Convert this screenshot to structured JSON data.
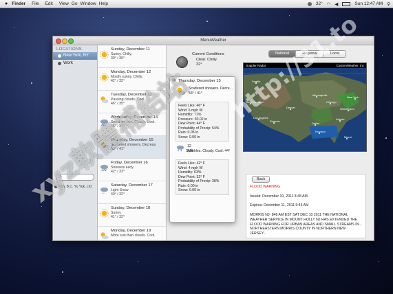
{
  "menubar": {
    "apple": "",
    "app": "Finder",
    "items": [
      "File",
      "Edit",
      "View",
      "Go",
      "Window",
      "Help"
    ],
    "weather": "32°",
    "clock": "Sun 12:47 AM"
  },
  "window": {
    "title": "MenuWeather"
  },
  "sidebar": {
    "header": "LOCATIONS",
    "locations": [
      {
        "label": "New York, NY"
      },
      {
        "label": "Work"
      }
    ],
    "search_placeholder": "Q-",
    "note": "Atlin, B.C. Yu Yuk, Ltd"
  },
  "forecast": [
    {
      "date": "Sunday, December 11",
      "desc": "Sunny. Chilly.",
      "temp": "39° / 30°",
      "icon": "sun-icon"
    },
    {
      "date": "Monday, December 12",
      "desc": "Mostly sunny. Chilly.",
      "temp": "42° / 32°",
      "icon": "sun-icon"
    },
    {
      "date": "Tuesday, December 13",
      "desc": "Passing clouds. Cool.",
      "temp": "46° / 35°",
      "icon": "partly-cloudy-icon"
    },
    {
      "date": "Wednesday, December 14",
      "desc": "Sprinkles late. Cloudy. Cool.",
      "temp": "46° / 37°",
      "icon": "rain-icon"
    },
    {
      "date": "Thursday, December 15",
      "desc": "Scattered showers. Decreas",
      "temp": "53° / 41°",
      "icon": "partly-cloudy-icon"
    },
    {
      "date": "Friday, December 16",
      "desc": "Showers early",
      "temp": "42° / 33°",
      "icon": "rain-icon"
    },
    {
      "date": "Saturday, December 17",
      "desc": "Light Snow",
      "temp": "40° / 32°",
      "icon": "snow-icon"
    },
    {
      "date": "Sunday, December 18",
      "desc": "Sunny.",
      "temp": "41° / 32°",
      "icon": "sun-icon"
    },
    {
      "date": "Monday, December 19",
      "desc": "More sun than clouds. Cool.",
      "temp": "",
      "icon": "partly-cloudy-icon"
    }
  ],
  "current": {
    "heading": "Current Conditions",
    "desc": "Clear. Chilly.",
    "temp": "32°"
  },
  "popover": {
    "date": "Thursday, December 15",
    "desc": "Scattered showers. Decre...",
    "temp": "53° / 41°",
    "day_details": [
      "Feels Like: 46° F",
      "Wind: 6 mph W",
      "Humidity: 71%",
      "Pressure: 30.02 in",
      "Dew Point: 44° F",
      "Probability of Precip: 54%",
      "Rain: 0.05 in",
      "Snow: 0.00 in"
    ],
    "night_time": "12 AM",
    "night_desc": "Sprinkles. Cloudy. Cool. 44°",
    "night_details": [
      "Feels Like: 42° F",
      "Wind: 4 mph W",
      "Humidity: 63%",
      "Dew Point: 32° F",
      "Probability of Precip: 38%",
      "Rain: 0.00 in",
      "Snow: 0.00 in"
    ]
  },
  "tabs": [
    {
      "label": "National",
      "active": true
    },
    {
      "label": "Regional",
      "active": false
    },
    {
      "label": "Local",
      "active": false
    }
  ],
  "map": {
    "left_label": "Doppler Radar",
    "right_label": "CustomWeather, Inc",
    "cities": [
      {
        "name": "Minneapolis"
      },
      {
        "name": "Chicago"
      },
      {
        "name": "Denver"
      },
      {
        "name": "New York"
      },
      {
        "name": "Washington"
      },
      {
        "name": "Atlanta"
      },
      {
        "name": "Dallas"
      },
      {
        "name": "Houston"
      },
      {
        "name": "Miami"
      },
      {
        "name": "San Francisco"
      },
      {
        "name": "Los Angeles"
      },
      {
        "name": "Phoenix"
      },
      {
        "name": "Seattle"
      }
    ]
  },
  "warning": {
    "back_label": "Back",
    "title": "FLOOD WARNING",
    "issued": "Issued: December 10, 2011 8:48 AM",
    "expires": "Expires: December 11, 2011 9:45 AM",
    "body": "MORRIS NJ- 848 AM EST SAT DEC 10 2011 THE NATIONAL WEATHER SERVICE IN MOUNT HOLLY NJ HAS EXTENDED THE FLOOD WARNING FOR URBAN AREAS AND SMALL STREAMS IN... NORTHEASTERN MORRIS COUNTY IN NORTHERN NEW JERSEY..."
  },
  "watermark": {
    "text1": "xyz軟體補給站",
    "text2": "http://31.to"
  }
}
